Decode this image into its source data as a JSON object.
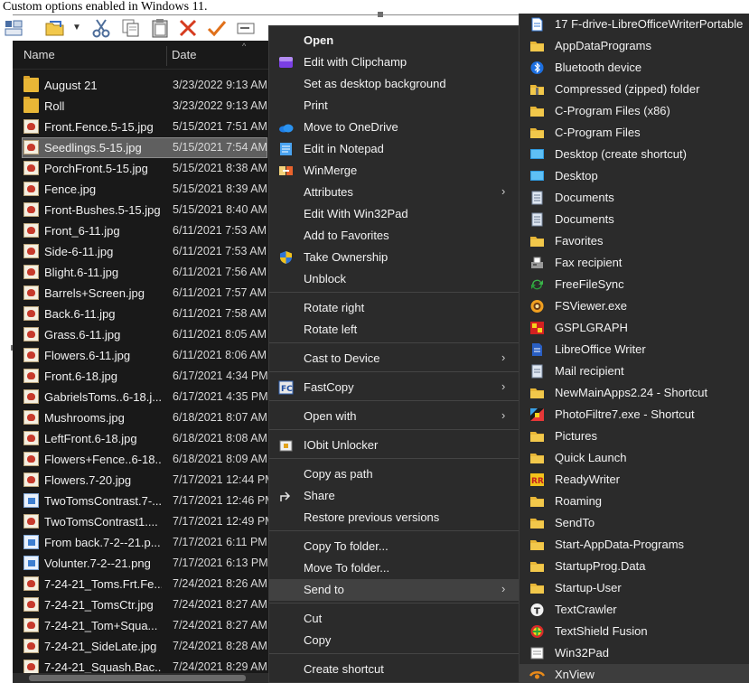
{
  "caption": "Custom options enabled in Windows 11.",
  "toolbar": {
    "icons": [
      "view-icon",
      "open-icon",
      "dropdown-icon",
      "cut-icon",
      "copy-icon",
      "paste-icon",
      "delete-icon",
      "check-icon",
      "rename-icon"
    ]
  },
  "explorer": {
    "col_name": "Name",
    "col_date": "Date",
    "files": [
      {
        "name": "August 21",
        "date": "3/23/2022 9:13 AM",
        "type": "folder"
      },
      {
        "name": "Roll",
        "date": "3/23/2022 9:13 AM",
        "type": "folder"
      },
      {
        "name": "Front.Fence.5-15.jpg",
        "date": "5/15/2021 7:51 AM",
        "type": "jpg"
      },
      {
        "name": "Seedlings.5-15.jpg",
        "date": "5/15/2021 7:54 AM",
        "type": "jpg",
        "selected": true
      },
      {
        "name": "PorchFront.5-15.jpg",
        "date": "5/15/2021 8:38 AM",
        "type": "jpg"
      },
      {
        "name": "Fence.jpg",
        "date": "5/15/2021 8:39 AM",
        "type": "jpg"
      },
      {
        "name": "Front-Bushes.5-15.jpg",
        "date": "5/15/2021 8:40 AM",
        "type": "jpg"
      },
      {
        "name": "Front_6-11.jpg",
        "date": "6/11/2021 7:53 AM",
        "type": "jpg"
      },
      {
        "name": "Side-6-11.jpg",
        "date": "6/11/2021 7:53 AM",
        "type": "jpg"
      },
      {
        "name": "Blight.6-11.jpg",
        "date": "6/11/2021 7:56 AM",
        "type": "jpg"
      },
      {
        "name": "Barrels+Screen.jpg",
        "date": "6/11/2021 7:57 AM",
        "type": "jpg"
      },
      {
        "name": "Back.6-11.jpg",
        "date": "6/11/2021 7:58 AM",
        "type": "jpg"
      },
      {
        "name": "Grass.6-11.jpg",
        "date": "6/11/2021 8:05 AM",
        "type": "jpg"
      },
      {
        "name": "Flowers.6-11.jpg",
        "date": "6/11/2021 8:06 AM",
        "type": "jpg"
      },
      {
        "name": "Front.6-18.jpg",
        "date": "6/17/2021 4:34 PM",
        "type": "jpg"
      },
      {
        "name": "GabrielsToms..6-18.j...",
        "date": "6/17/2021 4:35 PM",
        "type": "jpg"
      },
      {
        "name": "Mushrooms.jpg",
        "date": "6/18/2021 8:07 AM",
        "type": "jpg"
      },
      {
        "name": "LeftFront.6-18.jpg",
        "date": "6/18/2021 8:08 AM",
        "type": "jpg"
      },
      {
        "name": "Flowers+Fence..6-18...",
        "date": "6/18/2021 8:09 AM",
        "type": "jpg"
      },
      {
        "name": "Flowers.7-20.jpg",
        "date": "7/17/2021 12:44 PM",
        "type": "jpg"
      },
      {
        "name": "TwoTomsContrast.7-...",
        "date": "7/17/2021 12:46 PM",
        "type": "png"
      },
      {
        "name": "TwoTomsContrast1....",
        "date": "7/17/2021 12:49 PM",
        "type": "jpg"
      },
      {
        "name": "From back.7-2--21.p...",
        "date": "7/17/2021 6:11 PM",
        "type": "png"
      },
      {
        "name": "Volunter.7-2--21.png",
        "date": "7/17/2021 6:13 PM",
        "type": "png"
      },
      {
        "name": "7-24-21_Toms.Frt.Fe...",
        "date": "7/24/2021 8:26 AM",
        "type": "jpg"
      },
      {
        "name": "7-24-21_TomsCtr.jpg",
        "date": "7/24/2021 8:27 AM",
        "type": "jpg"
      },
      {
        "name": "7-24-21_Tom+Squa...",
        "date": "7/24/2021 8:27 AM",
        "type": "jpg"
      },
      {
        "name": "7-24-21_SideLate.jpg",
        "date": "7/24/2021 8:28 AM",
        "type": "jpg"
      },
      {
        "name": "7-24-21_Squash.Bac...",
        "date": "7/24/2021 8:29 AM",
        "type": "jpg"
      }
    ]
  },
  "context_menu": {
    "items": [
      {
        "label": "Open",
        "bold": true,
        "icon": ""
      },
      {
        "label": "Edit with Clipchamp",
        "icon": "clipchamp-icon"
      },
      {
        "label": "Set as desktop background",
        "icon": ""
      },
      {
        "label": "Print",
        "icon": ""
      },
      {
        "label": "Move to OneDrive",
        "icon": "onedrive-icon"
      },
      {
        "label": "Edit in Notepad",
        "icon": "notepad-icon"
      },
      {
        "label": "WinMerge",
        "icon": "winmerge-icon"
      },
      {
        "label": "Attributes",
        "icon": "",
        "submenu": true
      },
      {
        "label": "Edit With Win32Pad",
        "icon": ""
      },
      {
        "label": "Add to Favorites",
        "icon": ""
      },
      {
        "label": "Take Ownership",
        "icon": "shield-icon"
      },
      {
        "label": "Unblock",
        "icon": ""
      },
      {
        "label": "Rotate right",
        "icon": ""
      },
      {
        "label": "Rotate left",
        "icon": ""
      },
      {
        "label": "Cast to Device",
        "icon": "",
        "submenu": true
      },
      {
        "label": "FastCopy",
        "icon": "fastcopy-icon",
        "submenu": true
      },
      {
        "label": "Open with",
        "icon": "",
        "submenu": true
      },
      {
        "label": "IObit Unlocker",
        "icon": "iobit-icon"
      },
      {
        "label": "Copy as path",
        "icon": ""
      },
      {
        "label": "Share",
        "icon": "share-icon"
      },
      {
        "label": "Restore previous versions",
        "icon": ""
      },
      {
        "label": "Copy To folder...",
        "icon": ""
      },
      {
        "label": "Move To folder...",
        "icon": ""
      },
      {
        "label": "Send to",
        "icon": "",
        "submenu": true,
        "highlighted": true
      },
      {
        "label": "Cut",
        "icon": ""
      },
      {
        "label": "Copy",
        "icon": ""
      },
      {
        "label": "Create shortcut",
        "icon": ""
      }
    ]
  },
  "send_to": {
    "items": [
      {
        "label": "17  F-drive-LibreOfficeWriterPortable",
        "icon": "document-icon"
      },
      {
        "label": "AppDataPrograms",
        "icon": "folder-icon"
      },
      {
        "label": "Bluetooth device",
        "icon": "bluetooth-icon"
      },
      {
        "label": "Compressed (zipped) folder",
        "icon": "zip-folder-icon"
      },
      {
        "label": "C-Program Files (x86)",
        "icon": "folder-icon"
      },
      {
        "label": "C-Program Files",
        "icon": "folder-icon"
      },
      {
        "label": "Desktop (create shortcut)",
        "icon": "desktop-icon"
      },
      {
        "label": "Desktop",
        "icon": "desktop-icon"
      },
      {
        "label": "Documents",
        "icon": "documents-icon"
      },
      {
        "label": "Documents",
        "icon": "documents-icon"
      },
      {
        "label": "Favorites",
        "icon": "folder-icon"
      },
      {
        "label": "Fax recipient",
        "icon": "fax-icon"
      },
      {
        "label": "FreeFileSync",
        "icon": "sync-icon"
      },
      {
        "label": "FSViewer.exe",
        "icon": "fsviewer-icon"
      },
      {
        "label": "GSPLGRAPH",
        "icon": "graph-icon"
      },
      {
        "label": "LibreOffice Writer",
        "icon": "writer-icon"
      },
      {
        "label": "Mail recipient",
        "icon": "mail-icon"
      },
      {
        "label": "NewMainApps2.24 - Shortcut",
        "icon": "folder-icon"
      },
      {
        "label": "PhotoFiltre7.exe - Shortcut",
        "icon": "photofiltre-icon"
      },
      {
        "label": "Pictures",
        "icon": "folder-icon"
      },
      {
        "label": "Quick Launch",
        "icon": "folder-icon"
      },
      {
        "label": "ReadyWriter",
        "icon": "readywriter-icon"
      },
      {
        "label": "Roaming",
        "icon": "folder-icon"
      },
      {
        "label": "SendTo",
        "icon": "folder-icon"
      },
      {
        "label": "Start-AppData-Programs",
        "icon": "folder-icon"
      },
      {
        "label": "StartupProg.Data",
        "icon": "folder-icon"
      },
      {
        "label": "Startup-User",
        "icon": "folder-icon"
      },
      {
        "label": "TextCrawler",
        "icon": "textcrawler-icon"
      },
      {
        "label": "TextShield Fusion",
        "icon": "textshield-icon"
      },
      {
        "label": "Win32Pad",
        "icon": "win32pad-icon"
      },
      {
        "label": "XnView",
        "icon": "xnview-icon",
        "highlighted": true
      }
    ]
  }
}
